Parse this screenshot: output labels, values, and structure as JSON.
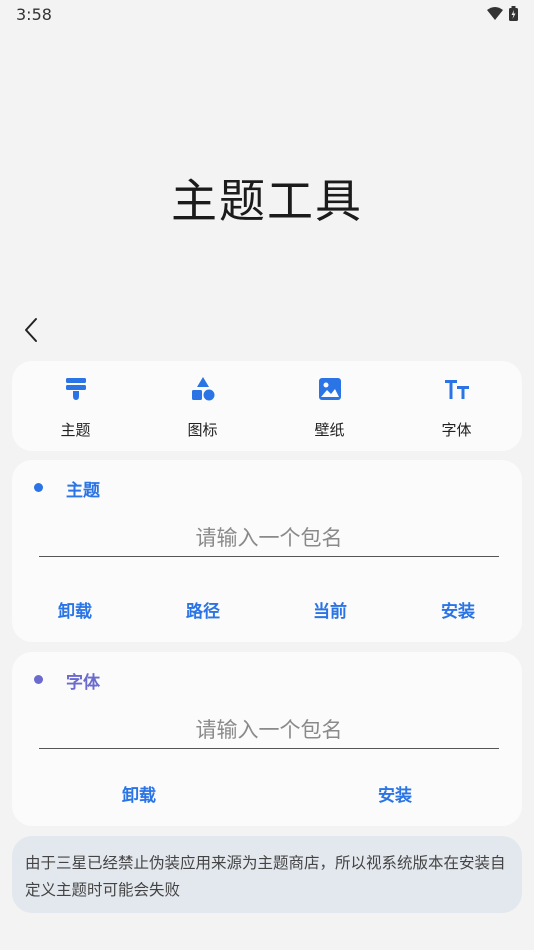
{
  "status": {
    "time": "3:58"
  },
  "title": "主题工具",
  "colors": {
    "accent": "#2a74e6",
    "font_dot": "#6a6acf",
    "card": "#fbfbfb",
    "notice_bg": "#e3e8ee"
  },
  "tabs": [
    {
      "label": "主题",
      "icon": "theme-brush-icon"
    },
    {
      "label": "图标",
      "icon": "shapes-icon"
    },
    {
      "label": "壁纸",
      "icon": "image-icon"
    },
    {
      "label": "字体",
      "icon": "font-size-icon"
    }
  ],
  "theme_section": {
    "title": "主题",
    "input_placeholder": "请输入一个包名",
    "actions": [
      "卸载",
      "路径",
      "当前",
      "安装"
    ]
  },
  "font_section": {
    "title": "字体",
    "input_placeholder": "请输入一个包名",
    "actions": [
      "卸载",
      "安装"
    ]
  },
  "notice": "由于三星已经禁止伪装应用来源为主题商店，所以视系统版本在安装自定义主题时可能会失败"
}
